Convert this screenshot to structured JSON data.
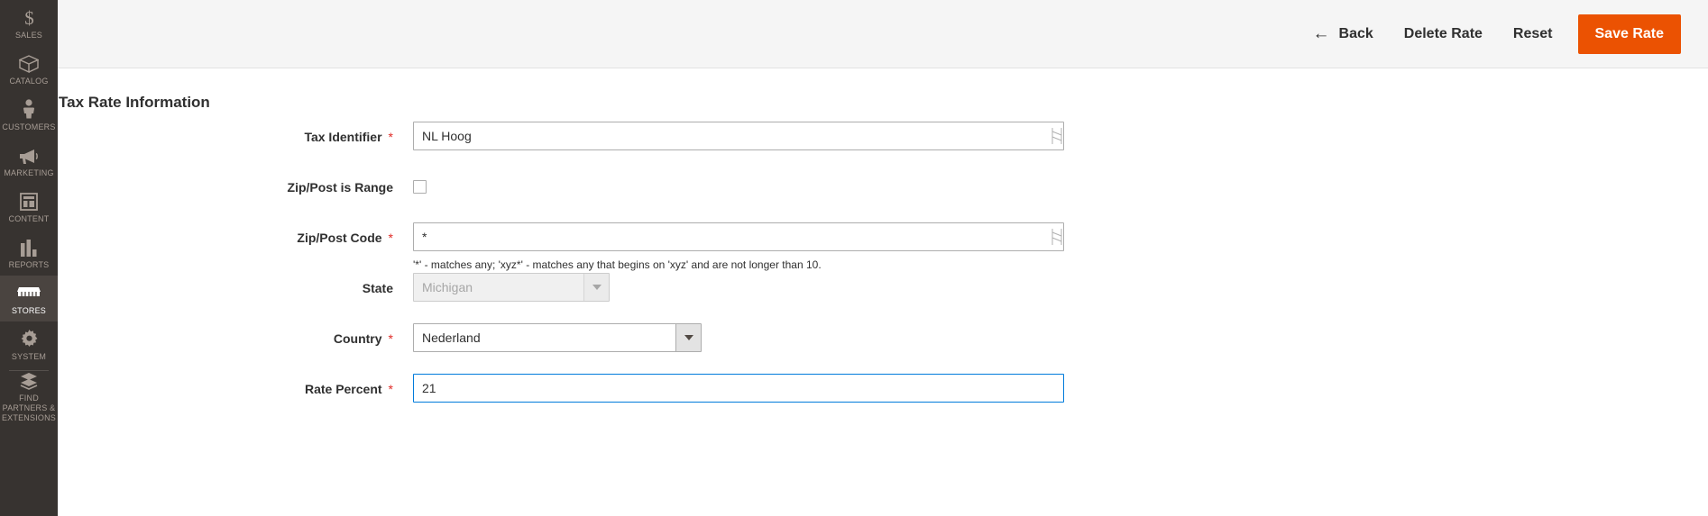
{
  "sidebar": {
    "items": [
      {
        "label": "SALES",
        "icon": "dollar-icon",
        "active": false
      },
      {
        "label": "CATALOG",
        "icon": "box-icon",
        "active": false
      },
      {
        "label": "CUSTOMERS",
        "icon": "person-icon",
        "active": false
      },
      {
        "label": "MARKETING",
        "icon": "megaphone-icon",
        "active": false
      },
      {
        "label": "CONTENT",
        "icon": "layout-icon",
        "active": false
      },
      {
        "label": "REPORTS",
        "icon": "bar-chart-icon",
        "active": false
      },
      {
        "label": "STORES",
        "icon": "store-icon",
        "active": true
      },
      {
        "label": "SYSTEM",
        "icon": "gear-icon",
        "active": false
      },
      {
        "label": "FIND PARTNERS & EXTENSIONS",
        "icon": "extensions-icon",
        "active": false
      }
    ]
  },
  "toolbar": {
    "back_label": "Back",
    "back_icon": "arrow-left-icon",
    "delete_label": "Delete Rate",
    "reset_label": "Reset",
    "save_label": "Save Rate",
    "save_color": "#eb5202"
  },
  "page": {
    "section_title": "Tax Rate Information"
  },
  "form": {
    "tax_identifier": {
      "label": "Tax Identifier",
      "required": "*",
      "value": "NL Hoog",
      "placeholder": ""
    },
    "zip_is_range": {
      "label": "Zip/Post is Range",
      "checked": false
    },
    "zip_code": {
      "label": "Zip/Post Code",
      "required": "*",
      "value": "*",
      "placeholder": "",
      "hint": "'*' - matches any; 'xyz*' - matches any that begins on 'xyz' and are not longer than 10."
    },
    "state": {
      "label": "State",
      "value": "Michigan",
      "disabled": true,
      "arrow_icon": "chevron-down-icon"
    },
    "country": {
      "label": "Country",
      "required": "*",
      "value": "Nederland",
      "arrow_icon": "chevron-down-icon"
    },
    "rate_percent": {
      "label": "Rate Percent",
      "required": "*",
      "value": "21",
      "placeholder": "",
      "focused": true,
      "focus_color": "#007bdb"
    }
  }
}
